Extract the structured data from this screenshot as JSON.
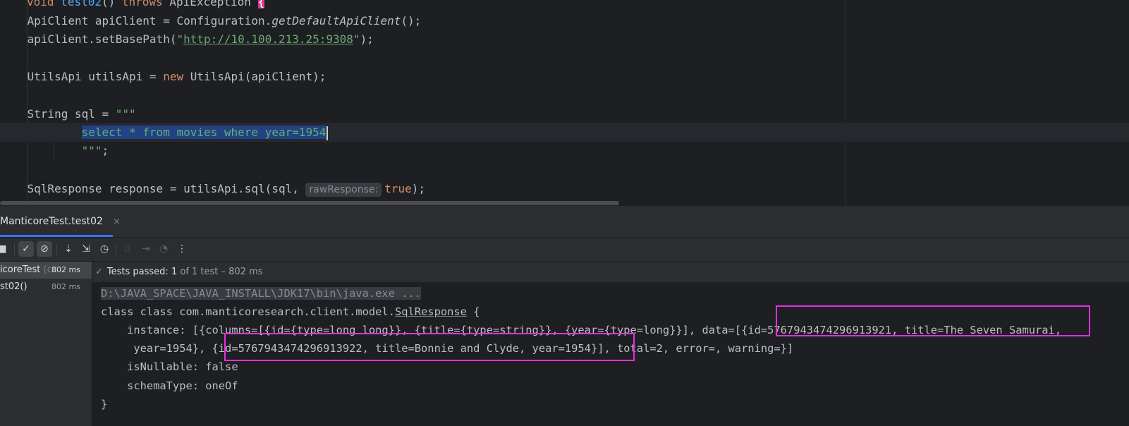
{
  "editor": {
    "lines": {
      "l0": {
        "k1": "void ",
        "fn": "test02",
        "p1": "() ",
        "k2": "throws",
        "p2": " ApiException ",
        "br": "{"
      },
      "l1": {
        "a": "    ApiClient apiClient = Configuration.",
        "it": "getDefaultApiClient",
        "b": "();"
      },
      "l2": {
        "a": "    apiClient.setBasePath(",
        "q1": "\"",
        "url": "http://10.100.213.25:9308",
        "q2": "\"",
        "b": ");"
      },
      "l4": {
        "a": "    UtilsApi utilsApi = ",
        "kw": "new",
        "b": " UtilsApi(apiClient);"
      },
      "l6": {
        "a": "    String sql = ",
        "str": "\"\"\""
      },
      "l7": {
        "indent": "            ",
        "sel": "select * from movies where year=1954"
      },
      "l8": {
        "indent": "            ",
        "str": "\"\"\"",
        "b": ";"
      },
      "l10": {
        "a": "    SqlResponse response = utilsApi.sql(sql, ",
        "hint": "rawResponse:",
        "kw": "true",
        "b": ");"
      }
    }
  },
  "run_panel": {
    "tab": {
      "label": "ManticoreTest.test02",
      "close": "×"
    },
    "toolbar": {
      "icons": [
        "stop-icon",
        "show-passed-icon",
        "show-ignored-icon",
        "sort-alpha-icon",
        "sort-duration-icon",
        "history-icon",
        "screenshot-icon",
        "export-icon",
        "settings-icon",
        "more-icon"
      ],
      "glyphs": {
        "stop": "■",
        "passed": "✓",
        "ignored": "⊘",
        "sort_a": "⇣",
        "sort_d": "⇲",
        "history": "◷",
        "camera": "⌷",
        "export": "⇥",
        "gauge": "◔",
        "more": "⋮"
      }
    },
    "tree": [
      {
        "name": "icoreTest",
        "extra": " (cc",
        "time": "802 ms"
      },
      {
        "name": "st02()",
        "extra": "",
        "time": "802 ms"
      }
    ],
    "status": {
      "check": "✓",
      "label": "Tests passed: ",
      "count": "1",
      "rest": " of 1 test – 802 ms"
    },
    "console": {
      "cmd": "D:\\JAVA_SPACE\\JAVA_INSTALL\\JDK17\\bin\\java.exe ...",
      "l1a": "class class com.manticoresearch.client.model.",
      "l1b": "SqlResponse",
      "l1c": " {",
      "l2": "    instance: [{columns=[{id={type=long long}}, {title={type=string}}, {year={type=long}}], data=[{id=5767943474296913921, title=The Seven Samurai,",
      "l3": "     year=1954}, {id=5767943474296913922, title=Bonnie and Clyde, year=1954}], total=2, error=, warning=}]",
      "l4": "    isNullable: false",
      "l5": "    schemaType: oneOf",
      "l6": "}"
    },
    "highlight_color": "#e030e0"
  }
}
